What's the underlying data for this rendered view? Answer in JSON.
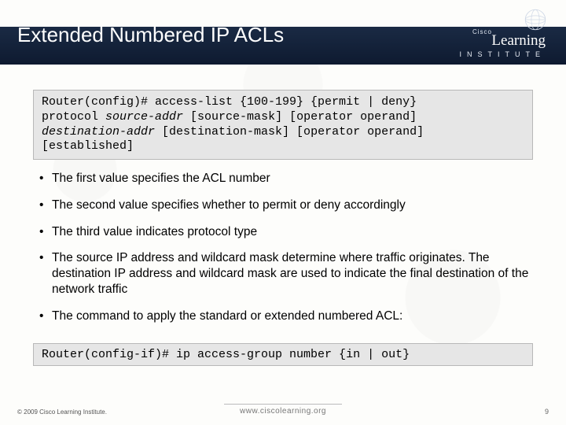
{
  "header": {
    "title": "Extended Numbered IP ACLs",
    "logo": {
      "brand": "Cisco",
      "line1": "Learning",
      "line2": "INSTITUTE"
    }
  },
  "code1": {
    "l1a": "Router(config)# access-list {100-199} {permit | deny} ",
    "l1b": "protocol ",
    "l1c": "source-addr",
    "l1d": " [source-mask] [operator operand] ",
    "l2a": "destination-addr",
    "l2b": " [destination-mask] [operator operand] ",
    "l3": "[established]"
  },
  "bullets": [
    "The first value specifies the ACL number",
    "The second value specifies whether to permit or deny accordingly",
    "The third value indicates protocol type",
    "The source IP address and wildcard mask determine where traffic originates. The destination IP address and wildcard mask are used to indicate the final destination of the network traffic",
    "The command to apply the standard or extended numbered ACL:"
  ],
  "code2": "Router(config-if)# ip access-group number {in | out}",
  "footer": {
    "copyright": "© 2009 Cisco Learning Institute.",
    "url": "www.ciscolearning.org",
    "page": "9"
  }
}
